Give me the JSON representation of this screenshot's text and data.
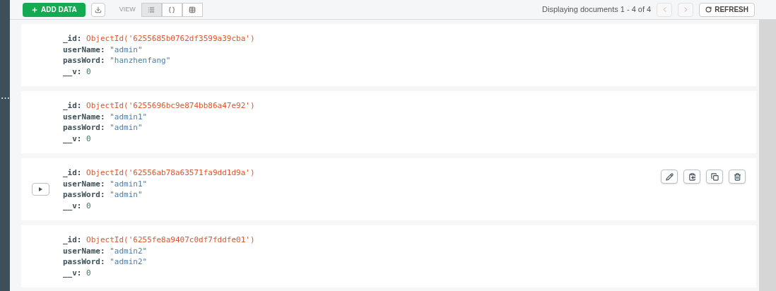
{
  "toolbar": {
    "add_button": "ADD DATA",
    "view_label": "VIEW",
    "views": [
      {
        "kind": "list",
        "selected": true
      },
      {
        "kind": "json",
        "selected": false
      },
      {
        "kind": "table",
        "selected": false
      }
    ],
    "paging": "Displaying documents 1 - 4 of 4",
    "refresh_button": "REFRESH"
  },
  "sidebar": {
    "handle": "⋯"
  },
  "documents": [
    {
      "actions_shown": false,
      "fields": [
        {
          "key": "_id:",
          "value": "ObjectId('6255685b0762df3599a39cba')",
          "kind": "objectid"
        },
        {
          "key": "userName:",
          "value": "\"admin\"",
          "kind": "string"
        },
        {
          "key": "passWord:",
          "value": "\"hanzhenfang\"",
          "kind": "string"
        },
        {
          "key": "__v:",
          "value": "0",
          "kind": "number"
        }
      ]
    },
    {
      "actions_shown": false,
      "fields": [
        {
          "key": "_id:",
          "value": "ObjectId('6255696bc9e874bb86a47e92')",
          "kind": "objectid"
        },
        {
          "key": "userName:",
          "value": "\"admin1\"",
          "kind": "string"
        },
        {
          "key": "passWord:",
          "value": "\"admin\"",
          "kind": "string"
        },
        {
          "key": "__v:",
          "value": "0",
          "kind": "number"
        }
      ]
    },
    {
      "actions_shown": true,
      "fields": [
        {
          "key": "_id:",
          "value": "ObjectId('62556ab78a63571fa9dd1d9a')",
          "kind": "objectid"
        },
        {
          "key": "userName:",
          "value": "\"admin1\"",
          "kind": "string"
        },
        {
          "key": "passWord:",
          "value": "\"admin\"",
          "kind": "string"
        },
        {
          "key": "__v:",
          "value": "0",
          "kind": "number"
        }
      ]
    },
    {
      "actions_shown": false,
      "fields": [
        {
          "key": "_id:",
          "value": "ObjectId('6255fe8a9407c0df7fddfe01')",
          "kind": "objectid"
        },
        {
          "key": "userName:",
          "value": "\"admin2\"",
          "kind": "string"
        },
        {
          "key": "passWord:",
          "value": "\"admin2\"",
          "kind": "string"
        },
        {
          "key": "__v:",
          "value": "0",
          "kind": "number"
        }
      ]
    }
  ]
}
